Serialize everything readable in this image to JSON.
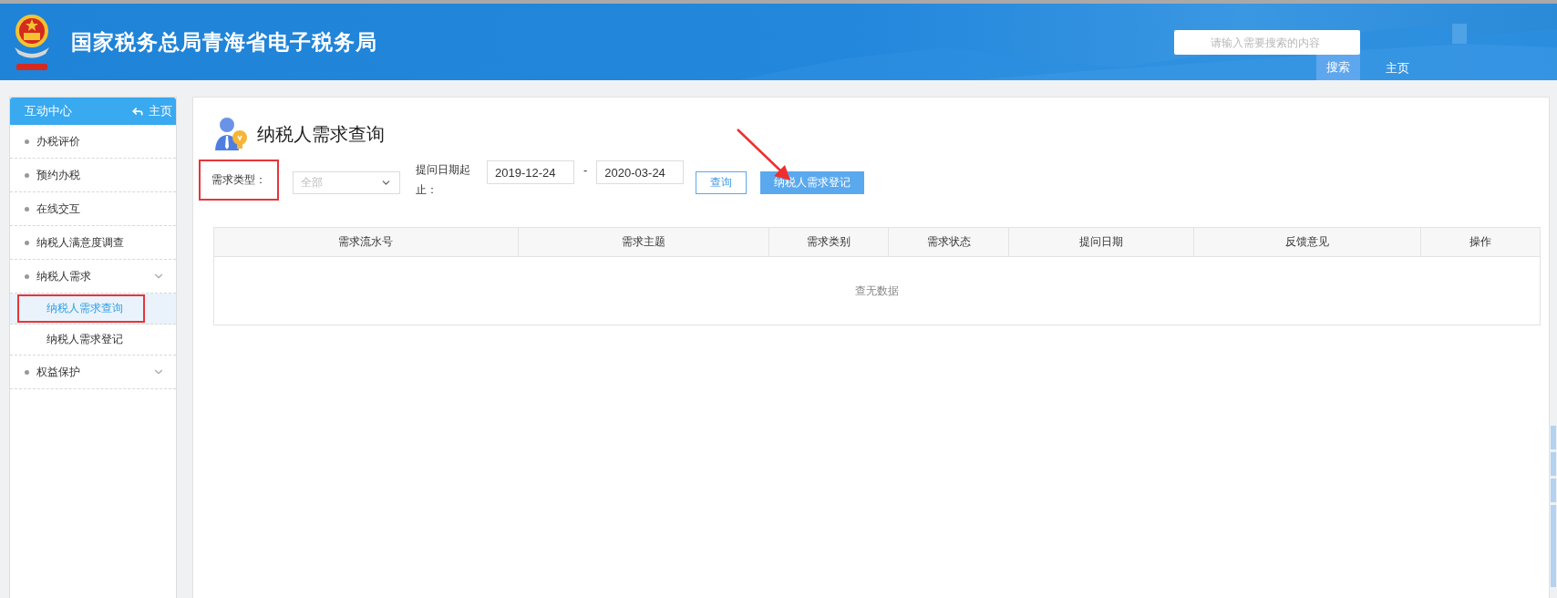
{
  "header": {
    "title": "国家税务总局青海省电子税务局",
    "search": {
      "placeholder": "请输入需要搜索的内容",
      "button": "搜索"
    },
    "home_link": "主页"
  },
  "sidebar": {
    "title": "互动中心",
    "home_link": "主页",
    "items": [
      {
        "label": "办税评价",
        "kind": "link",
        "selected": false
      },
      {
        "label": "预约办税",
        "kind": "link",
        "selected": false
      },
      {
        "label": "在线交互",
        "kind": "link",
        "selected": false
      },
      {
        "label": "纳税人满意度调查",
        "kind": "link",
        "selected": false
      },
      {
        "label": "纳税人需求",
        "kind": "group",
        "selected": false,
        "children": [
          {
            "label": "纳税人需求查询",
            "selected": true,
            "highlighted": true
          },
          {
            "label": "纳税人需求登记",
            "selected": false,
            "highlighted": false
          }
        ]
      },
      {
        "label": "权益保护",
        "kind": "group",
        "selected": false
      }
    ]
  },
  "page": {
    "title": "纳税人需求查询",
    "filters": {
      "type_label": "需求类型：",
      "type_label_highlighted": true,
      "type_value": "全部",
      "date_label": "提问日期起止：",
      "date_from": "2019-12-24",
      "date_separator": "-",
      "date_to": "2020-03-24"
    },
    "annotation_arrow": true,
    "buttons": [
      {
        "label": "查询",
        "kind": "outline"
      },
      {
        "label": "纳税人需求登记",
        "kind": "primary"
      }
    ]
  },
  "table": {
    "columns": [
      "需求流水号",
      "需求主题",
      "需求类别",
      "需求状态",
      "提问日期",
      "反馈意见",
      "操作"
    ],
    "empty_text": "查无数据"
  }
}
